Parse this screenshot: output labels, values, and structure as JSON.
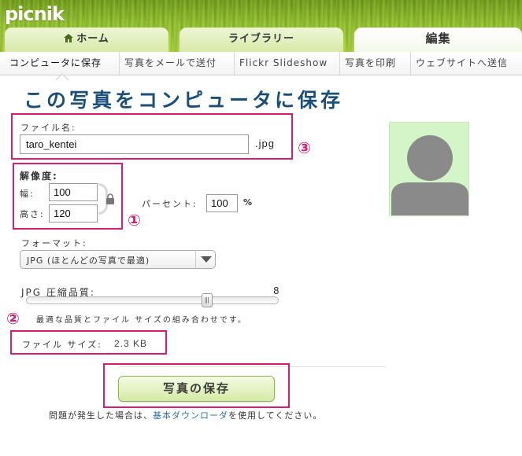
{
  "app": {
    "logo": "picnik"
  },
  "tabs": [
    {
      "label": "ホーム",
      "icon": "home-icon"
    },
    {
      "label": "ライブラリー"
    },
    {
      "label": "編集"
    }
  ],
  "subnav": [
    "コンピュータに保存",
    "写真をメールで送付",
    "Flickr Slideshow",
    "写真を印刷",
    "ウェブサイトへ送信"
  ],
  "title": "この写真をコンピュータに保存",
  "filename": {
    "label": "ファイル名:",
    "value": "taro_kentei",
    "ext": ".jpg"
  },
  "resolution": {
    "label": "解像度:",
    "width_label": "幅:",
    "width_value": "100",
    "height_label": "高さ:",
    "height_value": "120",
    "percent_label": "パーセント:",
    "percent_value": "100",
    "percent_unit": "%"
  },
  "format": {
    "label": "フォーマット:",
    "selected": "JPG (ほとんどの写真で最適)"
  },
  "quality": {
    "label": "JPG 圧縮品質:",
    "value_text": "8",
    "value": 8,
    "min": 0,
    "max": 10,
    "hint": "最適な品質とファイル サイズの組み合わせです。"
  },
  "filesize": {
    "label": "ファイル サイズ:",
    "value": "2.3 KB"
  },
  "save_button": "写真の保存",
  "help": {
    "prefix": "問題が発生した場合は、",
    "link": "基本ダウンローダ",
    "suffix": "を使用してください。"
  },
  "annotations": [
    "①",
    "②",
    "③"
  ],
  "colors": {
    "highlight": "#d81b73",
    "title": "#1b4f7a",
    "avatar_bg": "#d4f5c8"
  }
}
